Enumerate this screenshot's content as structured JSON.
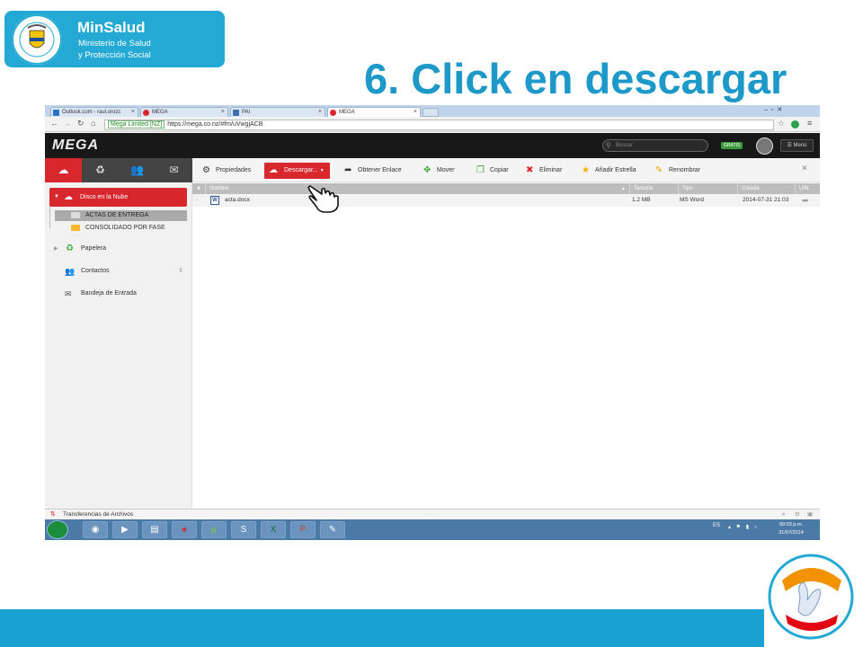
{
  "slide": {
    "title": "6. Click en descargar",
    "logo": {
      "name": "MinSalud",
      "subtitle_line1": "Ministerio de Salud",
      "subtitle_line2": "y Protección Social"
    },
    "campaign_badge": "todos-los-dias-son-dias-de-vacunacion-badge"
  },
  "browser": {
    "tabs": [
      {
        "label": "Outlook.com - raul.orozc",
        "icon": "outlook-icon",
        "active": false
      },
      {
        "label": "MEGA",
        "icon": "mega-icon",
        "active": false
      },
      {
        "label": "PAI",
        "icon": "pai-icon",
        "active": false
      },
      {
        "label": "MEGA",
        "icon": "mega-icon",
        "active": true
      }
    ],
    "secure_label": "Mega Limited [NZ]",
    "url": "https://mega.co.nz/#fm/uVwgjACB"
  },
  "mega": {
    "logo": "MEGA",
    "search_placeholder": "Buscar",
    "plan_badge": "GRATIS",
    "menu_label": "☰ Menú",
    "sidebar": {
      "cloud_drive": "Disco en la Nube",
      "folders": [
        "ACTAS DE ENTREGA",
        "CONSOLIDADO POR FASE"
      ],
      "trash": "Papelera",
      "contacts": "Contactos",
      "inbox": "Bandeja de Entrada"
    },
    "toolbar": {
      "properties": "Propiedades",
      "download": "Descargar...",
      "get_link": "Obtener Enlace",
      "move": "Mover",
      "copy": "Copiar",
      "delete": "Eliminar",
      "star": "Añadir Estrella",
      "rename": "Renombrar"
    },
    "table": {
      "columns": [
        "Nombre",
        "Tamaño",
        "Tipo",
        "Creada",
        "URL"
      ],
      "rows": [
        {
          "name": "acta.docx",
          "size": "1.2 MB",
          "type": "MS Word",
          "created": "2014-07-31 21:03"
        }
      ]
    },
    "transfers_label": "Transferencias de Archivos"
  },
  "taskbar": {
    "language": "ES",
    "time": "09:03 p.m.",
    "date": "31/07/2014",
    "apps": [
      "chrome-icon",
      "media-player-icon",
      "file-explorer-icon",
      "poker-icon",
      "utorrent-icon",
      "skype-icon",
      "excel-icon",
      "powerpoint-icon",
      "paint-icon"
    ]
  },
  "colors": {
    "brand_blue": "#23a9d4",
    "title_blue": "#1c98c9",
    "mega_red": "#d9272e"
  }
}
